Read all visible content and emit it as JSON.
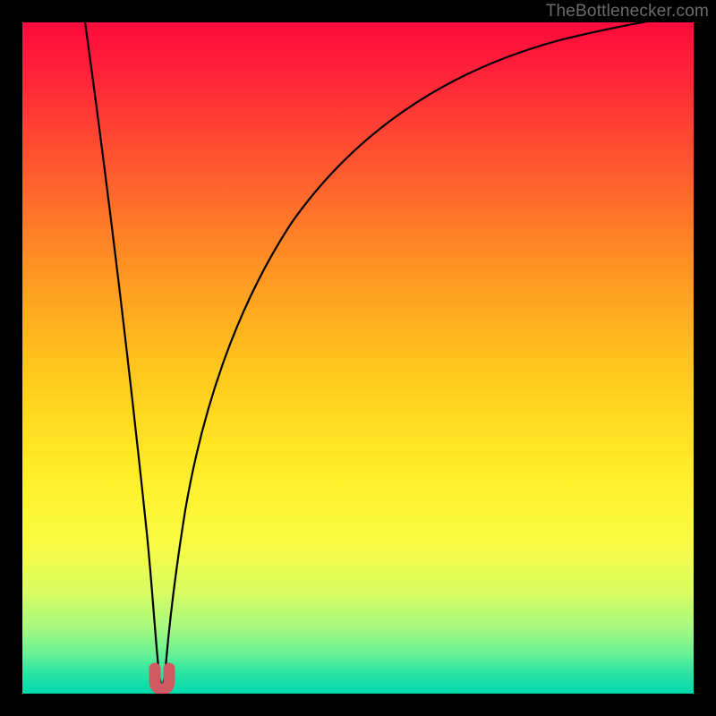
{
  "watermark": "TheBottlenecker.com",
  "colors": {
    "curve_stroke": "#000000",
    "marker_fill": "#cf5a61",
    "marker_stroke": "#cf5a61",
    "frame_bg": "#000000"
  },
  "chart_data": {
    "type": "line",
    "title": "",
    "xlabel": "",
    "ylabel": "",
    "xlim": [
      0,
      100
    ],
    "ylim": [
      0,
      100
    ],
    "x": [
      0,
      2,
      4,
      6,
      8,
      10,
      12,
      14,
      16,
      18,
      19,
      19.5,
      20,
      20.5,
      21,
      21.5,
      22,
      22.5,
      23,
      24,
      26,
      28,
      30,
      34,
      38,
      42,
      46,
      50,
      54,
      58,
      62,
      66,
      70,
      74,
      78,
      82,
      86,
      90,
      94,
      98,
      100
    ],
    "series": [
      {
        "name": "bottleneck-curve",
        "values": [
          116,
          103,
          91,
          80,
          69,
          58,
          48,
          38,
          27,
          14,
          7,
          3.5,
          1.5,
          1,
          1.5,
          3.5,
          7,
          11,
          15,
          22,
          32,
          40,
          46,
          55,
          61,
          67,
          71,
          75,
          78,
          81,
          83.5,
          85.7,
          87.6,
          89.3,
          90.8,
          92.1,
          93.3,
          94.3,
          95.2,
          96,
          96.4
        ]
      }
    ],
    "marker": {
      "x_range": [
        19.3,
        21.5
      ],
      "y": 1.0,
      "shape": "U"
    },
    "background_gradient": "red-yellow-green (top to bottom)"
  }
}
